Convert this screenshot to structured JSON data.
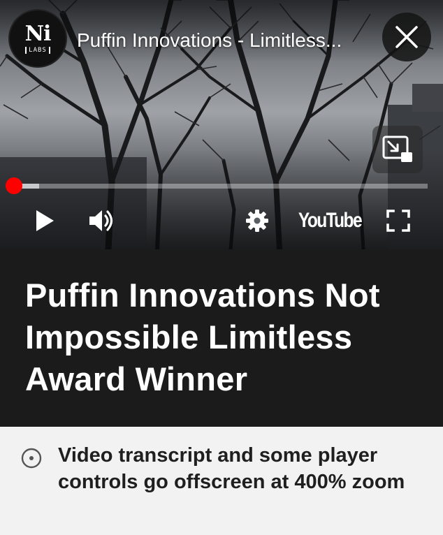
{
  "player": {
    "channel_logo": {
      "main": "Ni",
      "sub": "LABS"
    },
    "title": "Puffin Innovations - Limitless...",
    "close_icon": "close-icon",
    "miniplayer_icon": "miniplayer-icon",
    "progress": {
      "played": 0.0,
      "buffered": 0.06
    },
    "controls": {
      "play_icon": "play-icon",
      "volume_icon": "volume-icon",
      "settings_icon": "gear-icon",
      "youtube_label": "YouTube",
      "fullscreen_icon": "fullscreen-icon"
    },
    "colors": {
      "progress": "#ff0000"
    }
  },
  "heading": {
    "text": "Puffin Innovations Not Impossible Limitless Award Winner"
  },
  "note": {
    "icon": "info-circle-icon",
    "text": "Video transcript and some player controls go offscreen at 400% zoom"
  }
}
